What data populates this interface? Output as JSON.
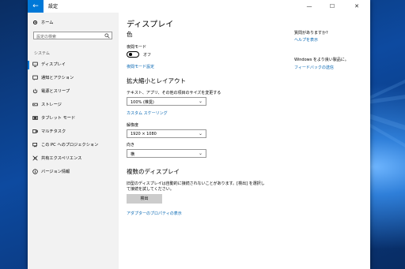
{
  "window": {
    "title": "設定",
    "back_glyph": "←",
    "minimize_glyph": "—",
    "maximize_glyph": "☐",
    "close_glyph": "✕"
  },
  "sidebar": {
    "home_label": "ホーム",
    "search_placeholder": "設定の検索",
    "section_label": "システム",
    "items": [
      {
        "label": "ディスプレイ",
        "icon": "display-icon"
      },
      {
        "label": "通知とアクション",
        "icon": "notification-icon"
      },
      {
        "label": "電源とスリープ",
        "icon": "power-icon"
      },
      {
        "label": "ストレージ",
        "icon": "storage-icon"
      },
      {
        "label": "タブレット モード",
        "icon": "tablet-icon"
      },
      {
        "label": "マルチタスク",
        "icon": "multitask-icon"
      },
      {
        "label": "この PC へのプロジェクション",
        "icon": "projection-icon"
      },
      {
        "label": "共有エクスペリエンス",
        "icon": "shared-icon"
      },
      {
        "label": "バージョン情報",
        "icon": "info-icon"
      }
    ]
  },
  "main": {
    "page_title": "ディスプレイ",
    "color_heading": "色",
    "night_mode_label": "夜間モード",
    "toggle_state": "オフ",
    "night_mode_settings_link": "夜間モード設定",
    "scale_heading": "拡大縮小とレイアウト",
    "scale_desc": "テキスト、アプリ、その他の項目のサイズを変更する",
    "scale_value": "100% (推奨)",
    "custom_scaling_link": "カスタム スケーリング",
    "resolution_label": "解像度",
    "resolution_value": "1920 × 1080",
    "orientation_label": "向き",
    "orientation_value": "横",
    "multi_heading": "複数のディスプレイ",
    "multi_desc_1": "旧型のディスプレイは自動的に接続されないことがあります。[検出] を選択し",
    "multi_desc_2": "て接続を試してください。",
    "detect_button": "検出",
    "adapter_link": "アダプターのプロパティの表示"
  },
  "aside": {
    "question": "質問がありますか?",
    "help_link": "ヘルプを表示",
    "improve": "Windows をより良い製品に。",
    "feedback_link": "フィードバックの送信"
  },
  "colors": {
    "accent": "#0078d7",
    "link": "#0063b1",
    "sidebar_bg": "#f2f2f2"
  }
}
